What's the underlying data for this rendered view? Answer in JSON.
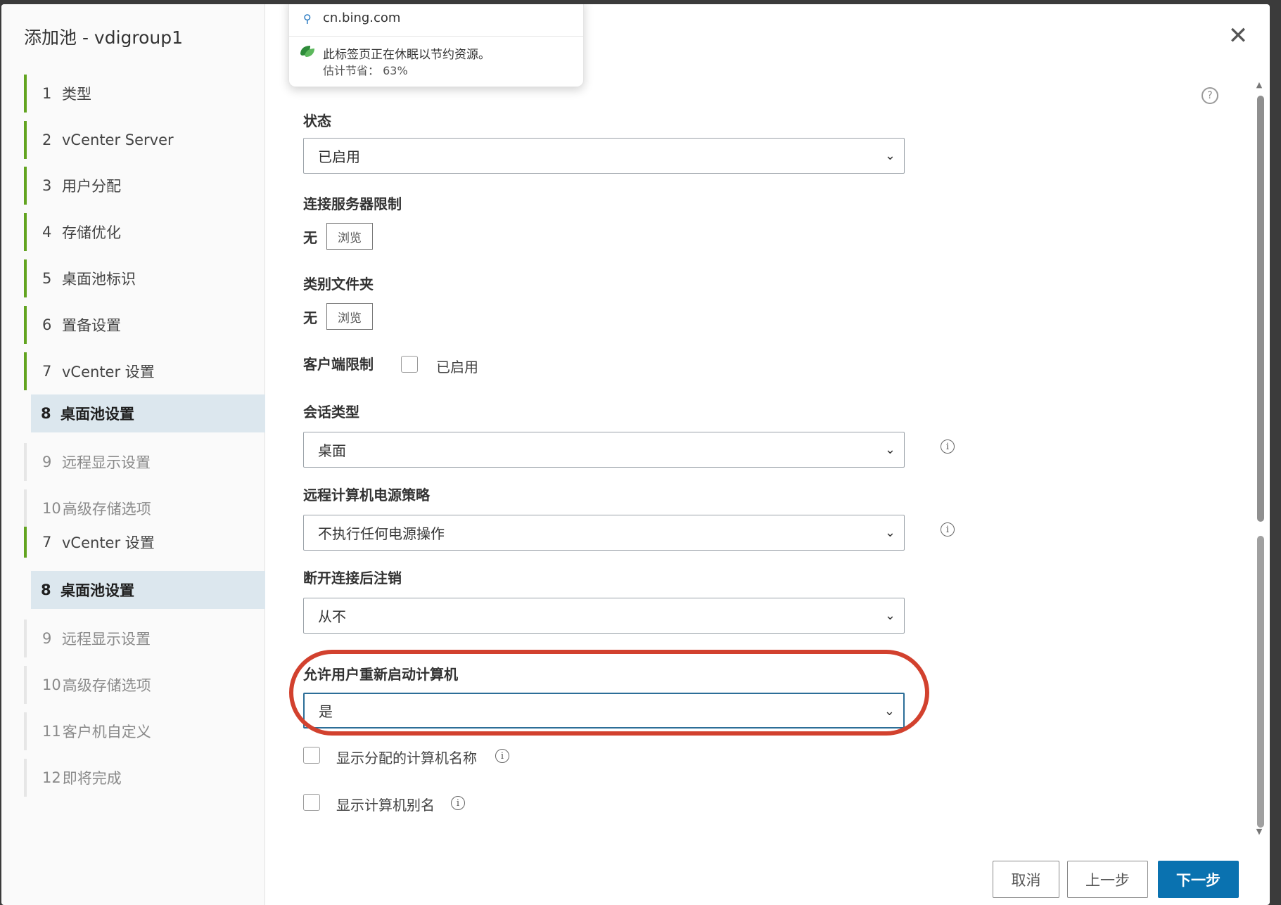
{
  "modal": {
    "title": "添加池 - vdigroup1",
    "close_label": "✕"
  },
  "steps": [
    {
      "num": "1",
      "label": "类型"
    },
    {
      "num": "2",
      "label": "vCenter Server"
    },
    {
      "num": "3",
      "label": "用户分配"
    },
    {
      "num": "4",
      "label": "存储优化"
    },
    {
      "num": "5",
      "label": "桌面池标识"
    },
    {
      "num": "6",
      "label": "置备设置"
    },
    {
      "num": "7",
      "label": "vCenter 设置"
    },
    {
      "num": "8",
      "label": "桌面池设置"
    },
    {
      "num": "9",
      "label": "远程显示设置"
    },
    {
      "num": "10",
      "label": "高级存储选项"
    },
    {
      "num": "7",
      "label": "vCenter 设置"
    },
    {
      "num": "8",
      "label": "桌面池设置"
    },
    {
      "num": "9",
      "label": "远程显示设置"
    },
    {
      "num": "10",
      "label": "高级存储选项"
    },
    {
      "num": "11",
      "label": "客户机自定义"
    },
    {
      "num": "12",
      "label": "即将完成"
    }
  ],
  "form": {
    "state": {
      "label": "状态",
      "value": "已启用"
    },
    "connection_server": {
      "label": "连接服务器限制",
      "value": "无",
      "browse": "浏览"
    },
    "category_folder": {
      "label": "类别文件夹",
      "value": "无",
      "browse": "浏览"
    },
    "client_restriction": {
      "label": "客户端限制",
      "checkbox_label": "已启用"
    },
    "session_type": {
      "label": "会话类型",
      "value": "桌面"
    },
    "power_policy": {
      "label": "远程计算机电源策略",
      "value": "不执行任何电源操作"
    },
    "logoff": {
      "label": "断开连接后注销",
      "value": "从不"
    },
    "allow_restart": {
      "label": "允许用户重新启动计算机",
      "value": "是"
    },
    "show_assigned_name": {
      "label": "显示分配的计算机名称"
    },
    "show_alias": {
      "label": "显示计算机别名"
    }
  },
  "footer": {
    "cancel": "取消",
    "back": "上一步",
    "next": "下一步"
  },
  "tab_popup": {
    "url": "cn.bing.com",
    "message": "此标签页正在休眠以节约资源。",
    "saving": "估计节省： 63%"
  },
  "colors": {
    "accent": "#0a72b0",
    "step_done": "#62a420",
    "current_step_bg": "#dce7ee",
    "highlight_ring": "#d2412e"
  }
}
